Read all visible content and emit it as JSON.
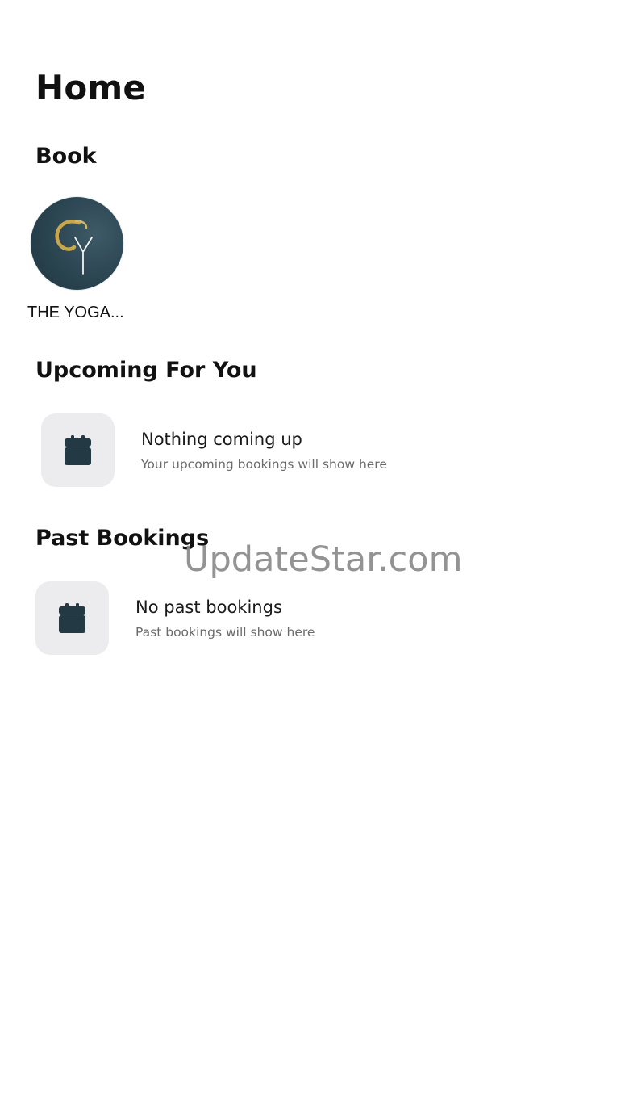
{
  "page": {
    "title": "Home"
  },
  "book": {
    "section_title": "Book",
    "studios": [
      {
        "name": "THE YOGA...",
        "logo_icon": "yoga-studio-logo"
      }
    ]
  },
  "upcoming": {
    "section_title": "Upcoming For You",
    "empty_icon": "calendar-icon",
    "empty_title": "Nothing coming up",
    "empty_subtitle": "Your upcoming bookings will show here"
  },
  "past": {
    "section_title": "Past Bookings",
    "empty_icon": "calendar-icon",
    "empty_title": "No past bookings",
    "empty_subtitle": "Past bookings will show here"
  },
  "watermark": {
    "text": "UpdateStar.com"
  },
  "colors": {
    "background": "#ffffff",
    "text_primary": "#111111",
    "text_secondary": "#6b6b6b",
    "icon_box": "#ececee",
    "calendar_icon": "#233a45",
    "logo_background": "#2a4450",
    "logo_accent": "#c9a649"
  }
}
